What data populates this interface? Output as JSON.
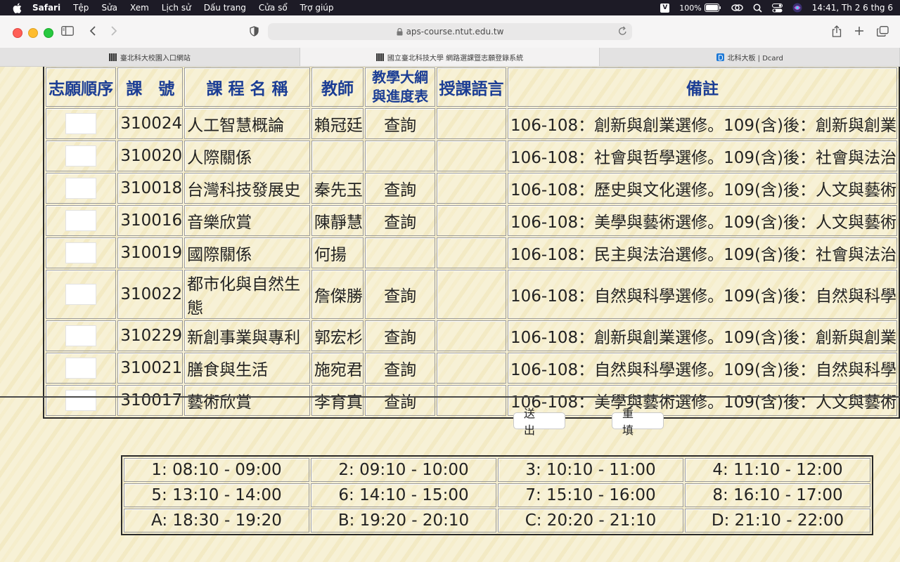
{
  "menubar": {
    "app": "Safari",
    "items": [
      "Tệp",
      "Sửa",
      "Xem",
      "Lịch sử",
      "Dấu trang",
      "Cửa sổ",
      "Trợ giúp"
    ],
    "input_method": "V",
    "battery": "100%",
    "clock": "14:41, Th 2 6 thg 6"
  },
  "browser": {
    "url": "aps-course.ntut.edu.tw",
    "tabs": [
      {
        "label": "臺北科大校園入口網站",
        "active": false,
        "icon": "ntut-favicon"
      },
      {
        "label": "國立臺北科技大學 網路選課暨志願登錄系統",
        "active": true,
        "icon": "ntut-favicon"
      },
      {
        "label": "北科大板 | Dcard",
        "active": false,
        "icon": "dcard-favicon"
      }
    ]
  },
  "table": {
    "headers": {
      "order": "志願順序",
      "code": "課　號",
      "name": "課 程 名 稱",
      "teacher": "教師",
      "syllabus": "教學大綱與進度表",
      "language": "授課語言",
      "note": "備註"
    },
    "rows": [
      {
        "code": "310024",
        "name": "人工智慧概論",
        "teacher": "賴冠廷",
        "syllabus": "查詢",
        "language": "",
        "note": "106-108：創新與創業選修。109(含)後：創新與創業"
      },
      {
        "code": "310020",
        "name": "人際關係",
        "teacher": "",
        "syllabus": "",
        "language": "",
        "note": "106-108：社會與哲學選修。109(含)後：社會與法治"
      },
      {
        "code": "310018",
        "name": "台灣科技發展史",
        "teacher": "秦先玉",
        "syllabus": "查詢",
        "language": "",
        "note": "106-108：歷史與文化選修。109(含)後：人文與藝術"
      },
      {
        "code": "310016",
        "name": "音樂欣賞",
        "teacher": "陳靜慧",
        "syllabus": "查詢",
        "language": "",
        "note": "106-108：美學與藝術選修。109(含)後：人文與藝術"
      },
      {
        "code": "310019",
        "name": "國際關係",
        "teacher": "何揚",
        "syllabus": "",
        "language": "",
        "note": "106-108：民主與法治選修。109(含)後：社會與法治"
      },
      {
        "code": "310022",
        "name": "都市化與自然生態",
        "teacher": "詹傑勝",
        "syllabus": "查詢",
        "language": "",
        "note": "106-108：自然與科學選修。109(含)後：自然與科學"
      },
      {
        "code": "310229",
        "name": "新創事業與專利",
        "teacher": "郭宏杉",
        "syllabus": "查詢",
        "language": "",
        "note": "106-108：創新與創業選修。109(含)後：創新與創業"
      },
      {
        "code": "310021",
        "name": "膳食與生活",
        "teacher": "施宛君",
        "syllabus": "查詢",
        "language": "",
        "note": "106-108：自然與科學選修。109(含)後：自然與科學"
      },
      {
        "code": "310017",
        "name": "藝術欣賞",
        "teacher": "李育真",
        "syllabus": "查詢",
        "language": "",
        "note": "106-108：美學與藝術選修。109(含)後：人文與藝術"
      }
    ]
  },
  "buttons": {
    "submit": "送出",
    "reset": "重填"
  },
  "periods": [
    [
      "1: 08:10 - 09:00",
      "2: 09:10 - 10:00",
      "3: 10:10 - 11:00",
      "4: 11:10 - 12:00"
    ],
    [
      "5: 13:10 - 14:00",
      "6: 14:10 - 15:00",
      "7: 15:10 - 16:00",
      "8: 16:10 - 17:00"
    ],
    [
      "A: 18:30 - 19:20",
      "B: 19:20 - 20:10",
      "C: 20:20 - 21:10",
      "D: 21:10 - 22:00"
    ]
  ]
}
